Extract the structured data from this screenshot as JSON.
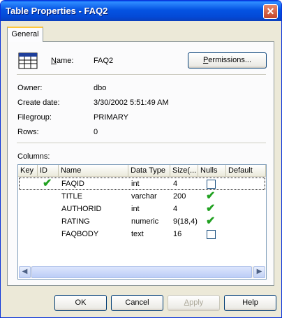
{
  "window": {
    "title": "Table Properties - FAQ2",
    "close_glyph": "✕"
  },
  "tabs": [
    {
      "label": "General"
    }
  ],
  "general": {
    "name_label": "Name:",
    "name_value": "FAQ2",
    "permissions_button": "Permissions...",
    "owner_label": "Owner:",
    "owner_value": "dbo",
    "create_date_label": "Create date:",
    "create_date_value": "3/30/2002 5:51:49 AM",
    "filegroup_label": "Filegroup:",
    "filegroup_value": "PRIMARY",
    "rows_label": "Rows:",
    "rows_value": "0",
    "columns_label": "Columns:"
  },
  "grid": {
    "headers": [
      "Key",
      "ID",
      "Name",
      "Data Type",
      "Size(...",
      "Nulls",
      "Default"
    ],
    "rows": [
      {
        "key": "",
        "id": true,
        "name": "FAQID",
        "type": "int",
        "size": "4",
        "nulls": false
      },
      {
        "key": "",
        "id": false,
        "name": "TITLE",
        "type": "varchar",
        "size": "200",
        "nulls": true
      },
      {
        "key": "",
        "id": false,
        "name": "AUTHORID",
        "type": "int",
        "size": "4",
        "nulls": true
      },
      {
        "key": "",
        "id": false,
        "name": "RATING",
        "type": "numeric",
        "size": "9(18,4)",
        "nulls": true
      },
      {
        "key": "",
        "id": false,
        "name": "FAQBODY",
        "type": "text",
        "size": "16",
        "nulls": false
      }
    ]
  },
  "buttons": {
    "ok": "OK",
    "cancel": "Cancel",
    "apply": "Apply",
    "help": "Help"
  },
  "colors": {
    "titlebar": "#0554e3",
    "dialog_bg": "#ece9d8",
    "check": "#21a121"
  }
}
